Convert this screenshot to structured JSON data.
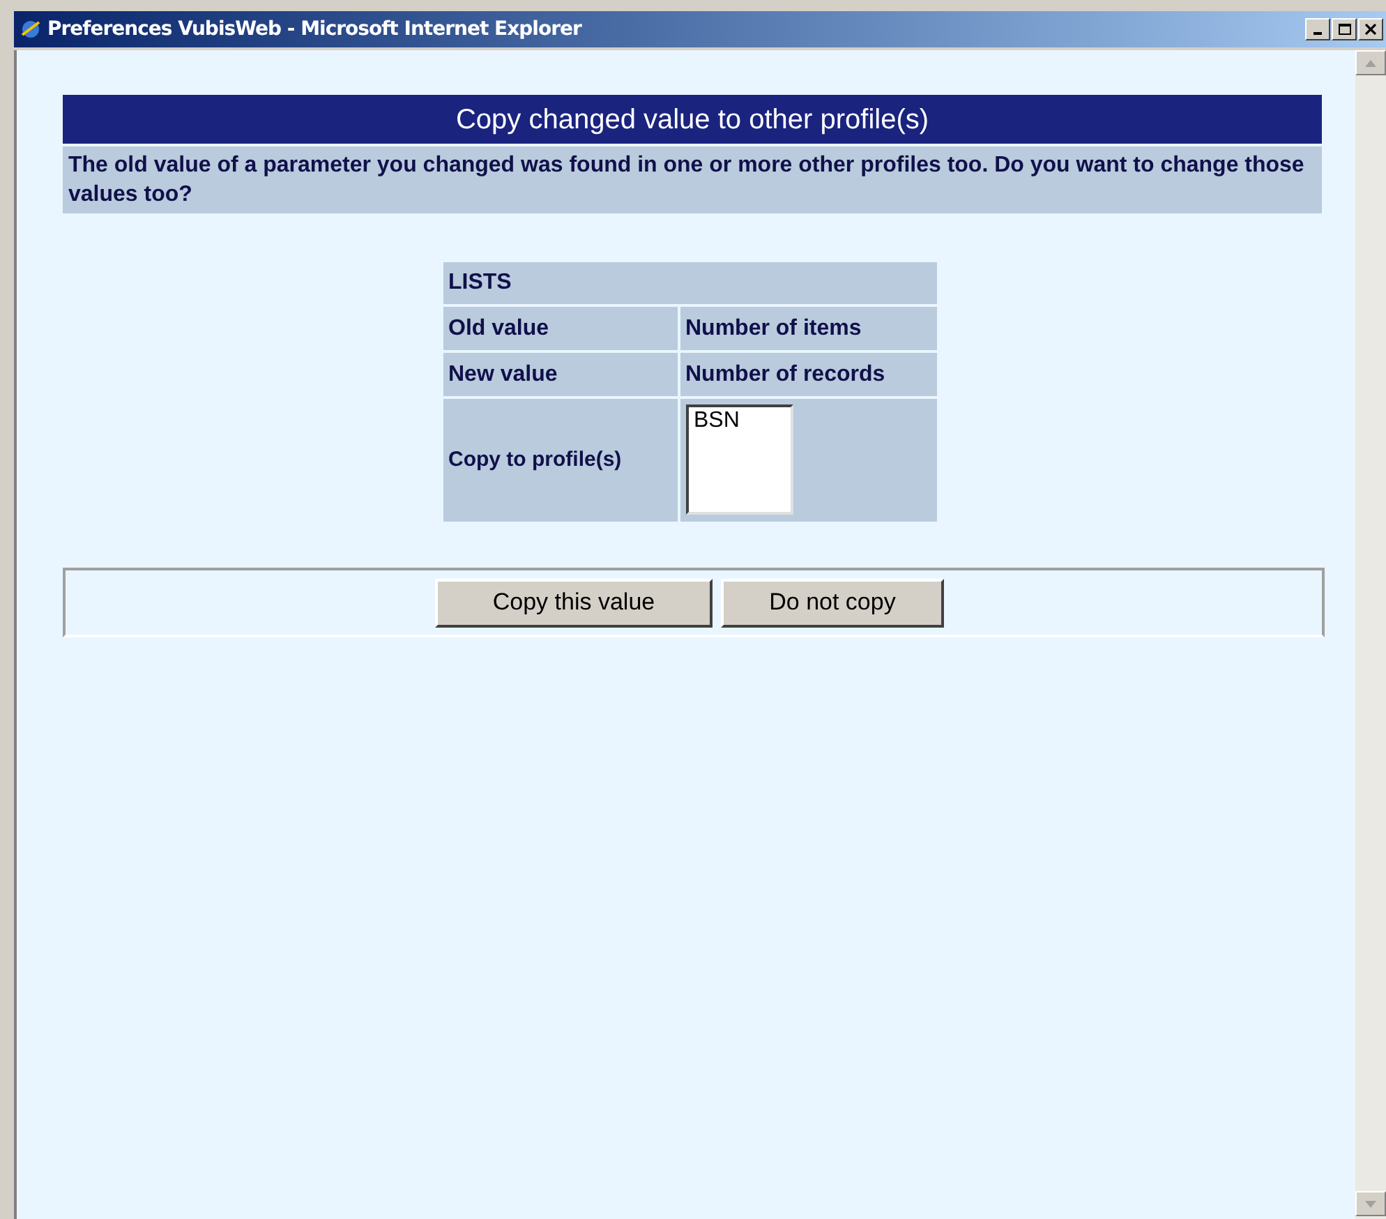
{
  "window": {
    "title": "Preferences VubisWeb - Microsoft Internet Explorer"
  },
  "heading": "Copy changed value to other profile(s)",
  "message": "The old value of a parameter you changed was found in one or more other profiles too. Do you want to change those values too?",
  "table": {
    "title": "LISTS",
    "rows": [
      {
        "label": "Old value",
        "value": "Number of items"
      },
      {
        "label": "New value",
        "value": "Number of records"
      }
    ],
    "profiles": {
      "label": "Copy to profile(s)",
      "options": [
        "BSN"
      ]
    }
  },
  "buttons": [
    "Copy this value",
    "Do not copy"
  ]
}
